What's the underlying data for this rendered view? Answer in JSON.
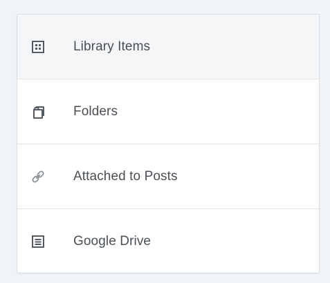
{
  "nav": {
    "items": [
      {
        "label": "Library Items",
        "icon": "grid-icon",
        "active": true
      },
      {
        "label": "Folders",
        "icon": "folders-icon",
        "active": false
      },
      {
        "label": "Attached to Posts",
        "icon": "link-icon",
        "active": false
      },
      {
        "label": "Google Drive",
        "icon": "document-icon",
        "active": false
      }
    ]
  },
  "colors": {
    "background": "#f1f4f6",
    "panel": "#ffffff",
    "active_item": "#f4f6f8",
    "text": "#4a4f55",
    "icon": "#555b61",
    "divider": "#dfe3e6"
  }
}
